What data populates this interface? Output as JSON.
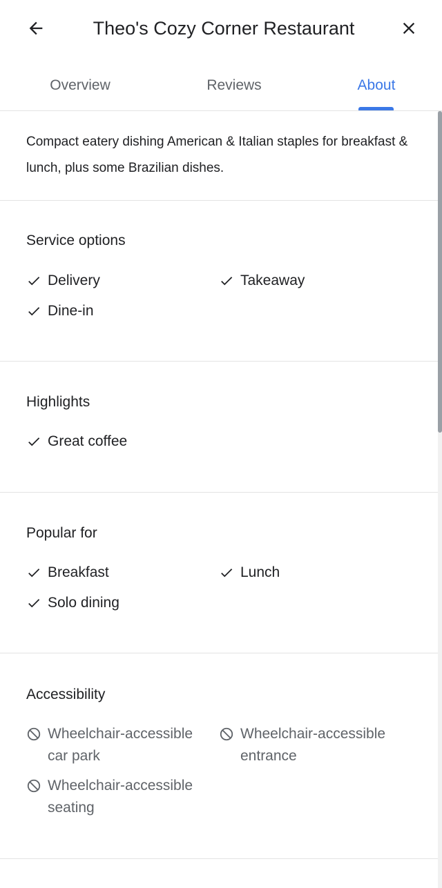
{
  "header": {
    "title": "Theo's Cozy Corner Restaurant",
    "back_icon": "arrow-back-icon",
    "close_icon": "close-icon"
  },
  "tabs": [
    {
      "label": "Overview",
      "active": false
    },
    {
      "label": "Reviews",
      "active": false
    },
    {
      "label": "About",
      "active": true
    }
  ],
  "description": "Compact eatery dishing American & Italian staples for breakfast & lunch, plus some Brazilian dishes.",
  "sections": {
    "service_options": {
      "title": "Service options",
      "items": [
        {
          "label": "Delivery",
          "available": true
        },
        {
          "label": "Takeaway",
          "available": true
        },
        {
          "label": "Dine-in",
          "available": true
        }
      ]
    },
    "highlights": {
      "title": "Highlights",
      "items": [
        {
          "label": "Great coffee",
          "available": true
        }
      ]
    },
    "popular_for": {
      "title": "Popular for",
      "items": [
        {
          "label": "Breakfast",
          "available": true
        },
        {
          "label": "Lunch",
          "available": true
        },
        {
          "label": "Solo dining",
          "available": true
        }
      ]
    },
    "accessibility": {
      "title": "Accessibility",
      "items": [
        {
          "label": "Wheelchair-accessible car park",
          "available": false
        },
        {
          "label": "Wheelchair-accessible entrance",
          "available": false
        },
        {
          "label": "Wheelchair-accessible seating",
          "available": false
        }
      ]
    }
  },
  "colors": {
    "accent": "#3b78e7",
    "text": "#202124",
    "secondary_text": "#5f6368",
    "divider": "#e3e3e3"
  }
}
